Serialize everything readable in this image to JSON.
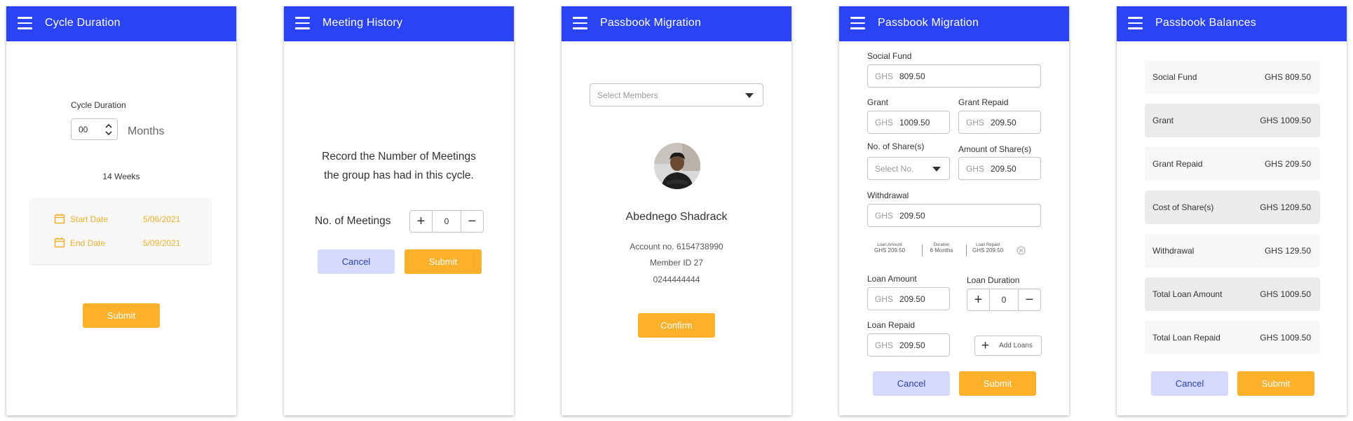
{
  "screens": {
    "cycle": {
      "title": "Cycle Duration",
      "label": "Cycle Duration",
      "value": "00",
      "unit": "Months",
      "weeks": "14 Weeks",
      "start_label": "Start Date",
      "start_value": "5/06/2021",
      "end_label": "End Date",
      "end_value": "5/09/2021",
      "submit": "Submit"
    },
    "meetings": {
      "title": "Meeting History",
      "instruction_line1": "Record the Number of Meetings",
      "instruction_line2": "the group has had in this cycle.",
      "meetings_label": "No. of Meetings",
      "meetings_value": "0",
      "cancel": "Cancel",
      "submit": "Submit"
    },
    "migration1": {
      "title": "Passbook Migration",
      "select_placeholder": "Select Members",
      "member_name": "Abednego Shadrack",
      "account": "Account no. 6154738990",
      "member_id": "Member ID 27",
      "phone": "0244444444",
      "confirm": "Confirm"
    },
    "migration2": {
      "title": "Passbook Migration",
      "currency": "GHS",
      "social_fund_label": "Social Fund",
      "social_fund": "809.50",
      "grant_label": "Grant",
      "grant": "1009.50",
      "grant_repaid_label": "Grant Repaid",
      "grant_repaid": "209.50",
      "shares_label": "No. of Share(s)",
      "shares_placeholder": "Select No.",
      "amount_shares_label": "Amount of Share(s)",
      "amount_shares": "209.50",
      "withdrawal_label": "Withdrawal",
      "withdrawal": "209.50",
      "summary": [
        {
          "head": "Loan Amount",
          "value": "GHS 209.50"
        },
        {
          "head": "Duration",
          "value": "6 Months"
        },
        {
          "head": "Loan Repaid",
          "value": "GHS 209.50"
        }
      ],
      "loan_amount_label": "Loan Amount",
      "loan_amount": "209.50",
      "loan_duration_label": "Loan Duration",
      "loan_duration": "0",
      "loan_repaid_label": "Loan Repaid",
      "loan_repaid": "209.50",
      "add_loans": "Add Loans",
      "cancel": "Cancel",
      "submit": "Submit"
    },
    "balances": {
      "title": "Passbook Balances",
      "rows": [
        {
          "label": "Social Fund",
          "value": "GHS 809.50"
        },
        {
          "label": "Grant",
          "value": "GHS 1009.50"
        },
        {
          "label": "Grant Repaid",
          "value": "GHS 209.50"
        },
        {
          "label": "Cost of Share(s)",
          "value": "GHS 1209.50"
        },
        {
          "label": "Withdrawal",
          "value": "GHS 129.50"
        },
        {
          "label": "Total Loan Amount",
          "value": "GHS 1009.50"
        },
        {
          "label": "Total Loan Repaid",
          "value": "GHS 1009.50"
        }
      ],
      "cancel": "Cancel",
      "submit": "Submit"
    }
  },
  "colors": {
    "appbar": "#2a44f5",
    "accent_orange": "#fdb02a",
    "cancel_bg": "#d5dafc",
    "date_text": "#f5b02a"
  }
}
